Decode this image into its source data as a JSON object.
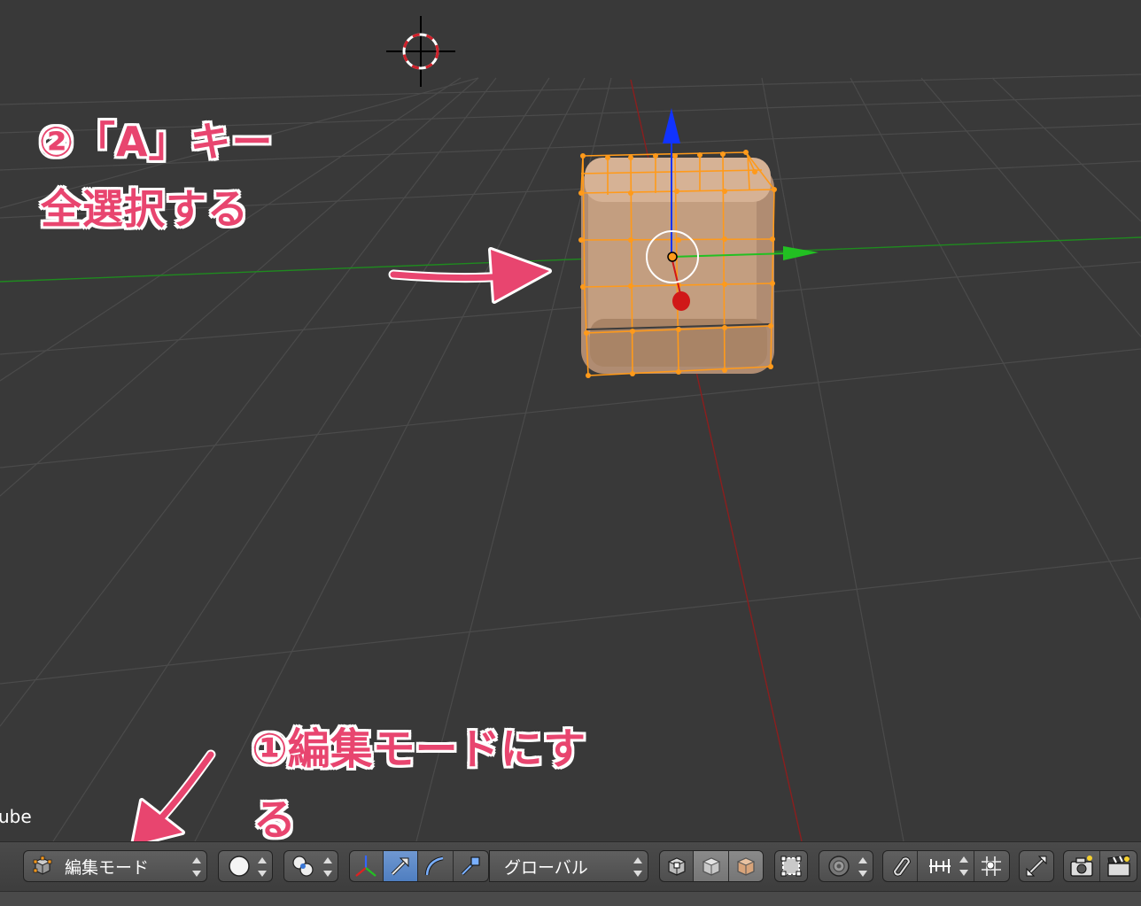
{
  "annotations": {
    "step2_line1": "②「A」キー",
    "step2_line2": "全選択する",
    "step1_line1": "①編集モードにす",
    "step1_line2": "る"
  },
  "viewport": {
    "object_name_partial": "ube"
  },
  "header": {
    "mode_select": {
      "value": "編集モード",
      "icon": "edit-mode-cube-icon"
    },
    "shading_select": {
      "icon": "solid-sphere-icon"
    },
    "pivot_select": {
      "icon": "pivot-point-icon"
    },
    "manipulator": {
      "toggle_icon": "manipulator-axes-icon",
      "translate_icon": "translate-arrow-icon",
      "rotate_icon": "rotate-arc-icon",
      "scale_icon": "scale-icon"
    },
    "orientation_select": {
      "value": "グローバル"
    },
    "select_mode": {
      "vertex_icon": "vertex-select-icon",
      "edge_icon": "edge-select-icon",
      "face_icon": "face-select-icon"
    },
    "occlude_icon": "limit-selection-icon",
    "proportional_icon": "proportional-edit-icon",
    "snap_icon": "magnet-snap-icon",
    "snap_element_icon": "snap-increment-icon",
    "snap_target_icon": "snap-target-icon",
    "mesh_tools_icon": "mesh-tools-icon",
    "render_icon": "render-camera-icon",
    "anim_render_icon": "render-animation-icon"
  },
  "colors": {
    "viewport_bg": "#393939",
    "selection_orange": "#ff9a1a",
    "annotation_pink": "#e8456f",
    "axis_x": "#c1272d",
    "axis_y": "#22c022",
    "axis_z": "#1133ff"
  }
}
